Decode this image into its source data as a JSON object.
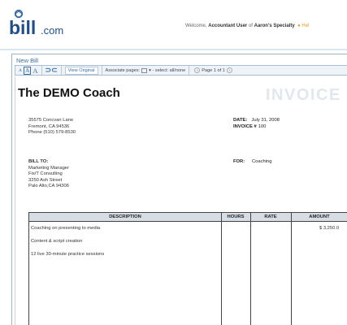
{
  "brand": {
    "logo_text": "bill",
    "logo_suffix": ".com",
    "accent": "#3a6ea5"
  },
  "header": {
    "welcome_prefix": "Welcome,",
    "welcome_user": "Accountant User",
    "welcome_of": "of",
    "company_link": "Aaron's Specialty",
    "help": "Hel"
  },
  "page": {
    "title": "New Bill"
  },
  "toolbar": {
    "zoom_labels": [
      "A",
      "A",
      "A"
    ],
    "rotate_label": "⊃⊂",
    "view_original": "View Original",
    "associate_pages": "Associate pages:",
    "select_all": "select: all/none",
    "page_info": "Page 1 of 1"
  },
  "invoice": {
    "company_name": "The DEMO Coach",
    "watermark": "INVOICE",
    "address": [
      "35575 Concvan Lane",
      "Fremont, CA  94536",
      "Phone (510) 579-8530"
    ],
    "bill_to_label": "BILL TO:",
    "bill_to": [
      "Marketing Manager",
      "Fix/T Consulting",
      "3250 Ash Street",
      "Palo Alto,CA  94306"
    ],
    "date_label": "DATE:",
    "date_value": "July 31, 2008",
    "invoice_no_label": "INVOICE #",
    "invoice_no_value": "100",
    "for_label": "FOR:",
    "for_value": "Coaching"
  },
  "table": {
    "headers": [
      "DESCRIPTION",
      "HOURS",
      "RATE",
      "AMOUNT"
    ],
    "rows": [
      {
        "description": "Coaching on presenting to media",
        "amount": "$ 3,250.0"
      },
      {
        "description": "Content & script creation",
        "amount": ""
      },
      {
        "description": "12 live 30-minute practice sessions",
        "amount": ""
      }
    ]
  }
}
